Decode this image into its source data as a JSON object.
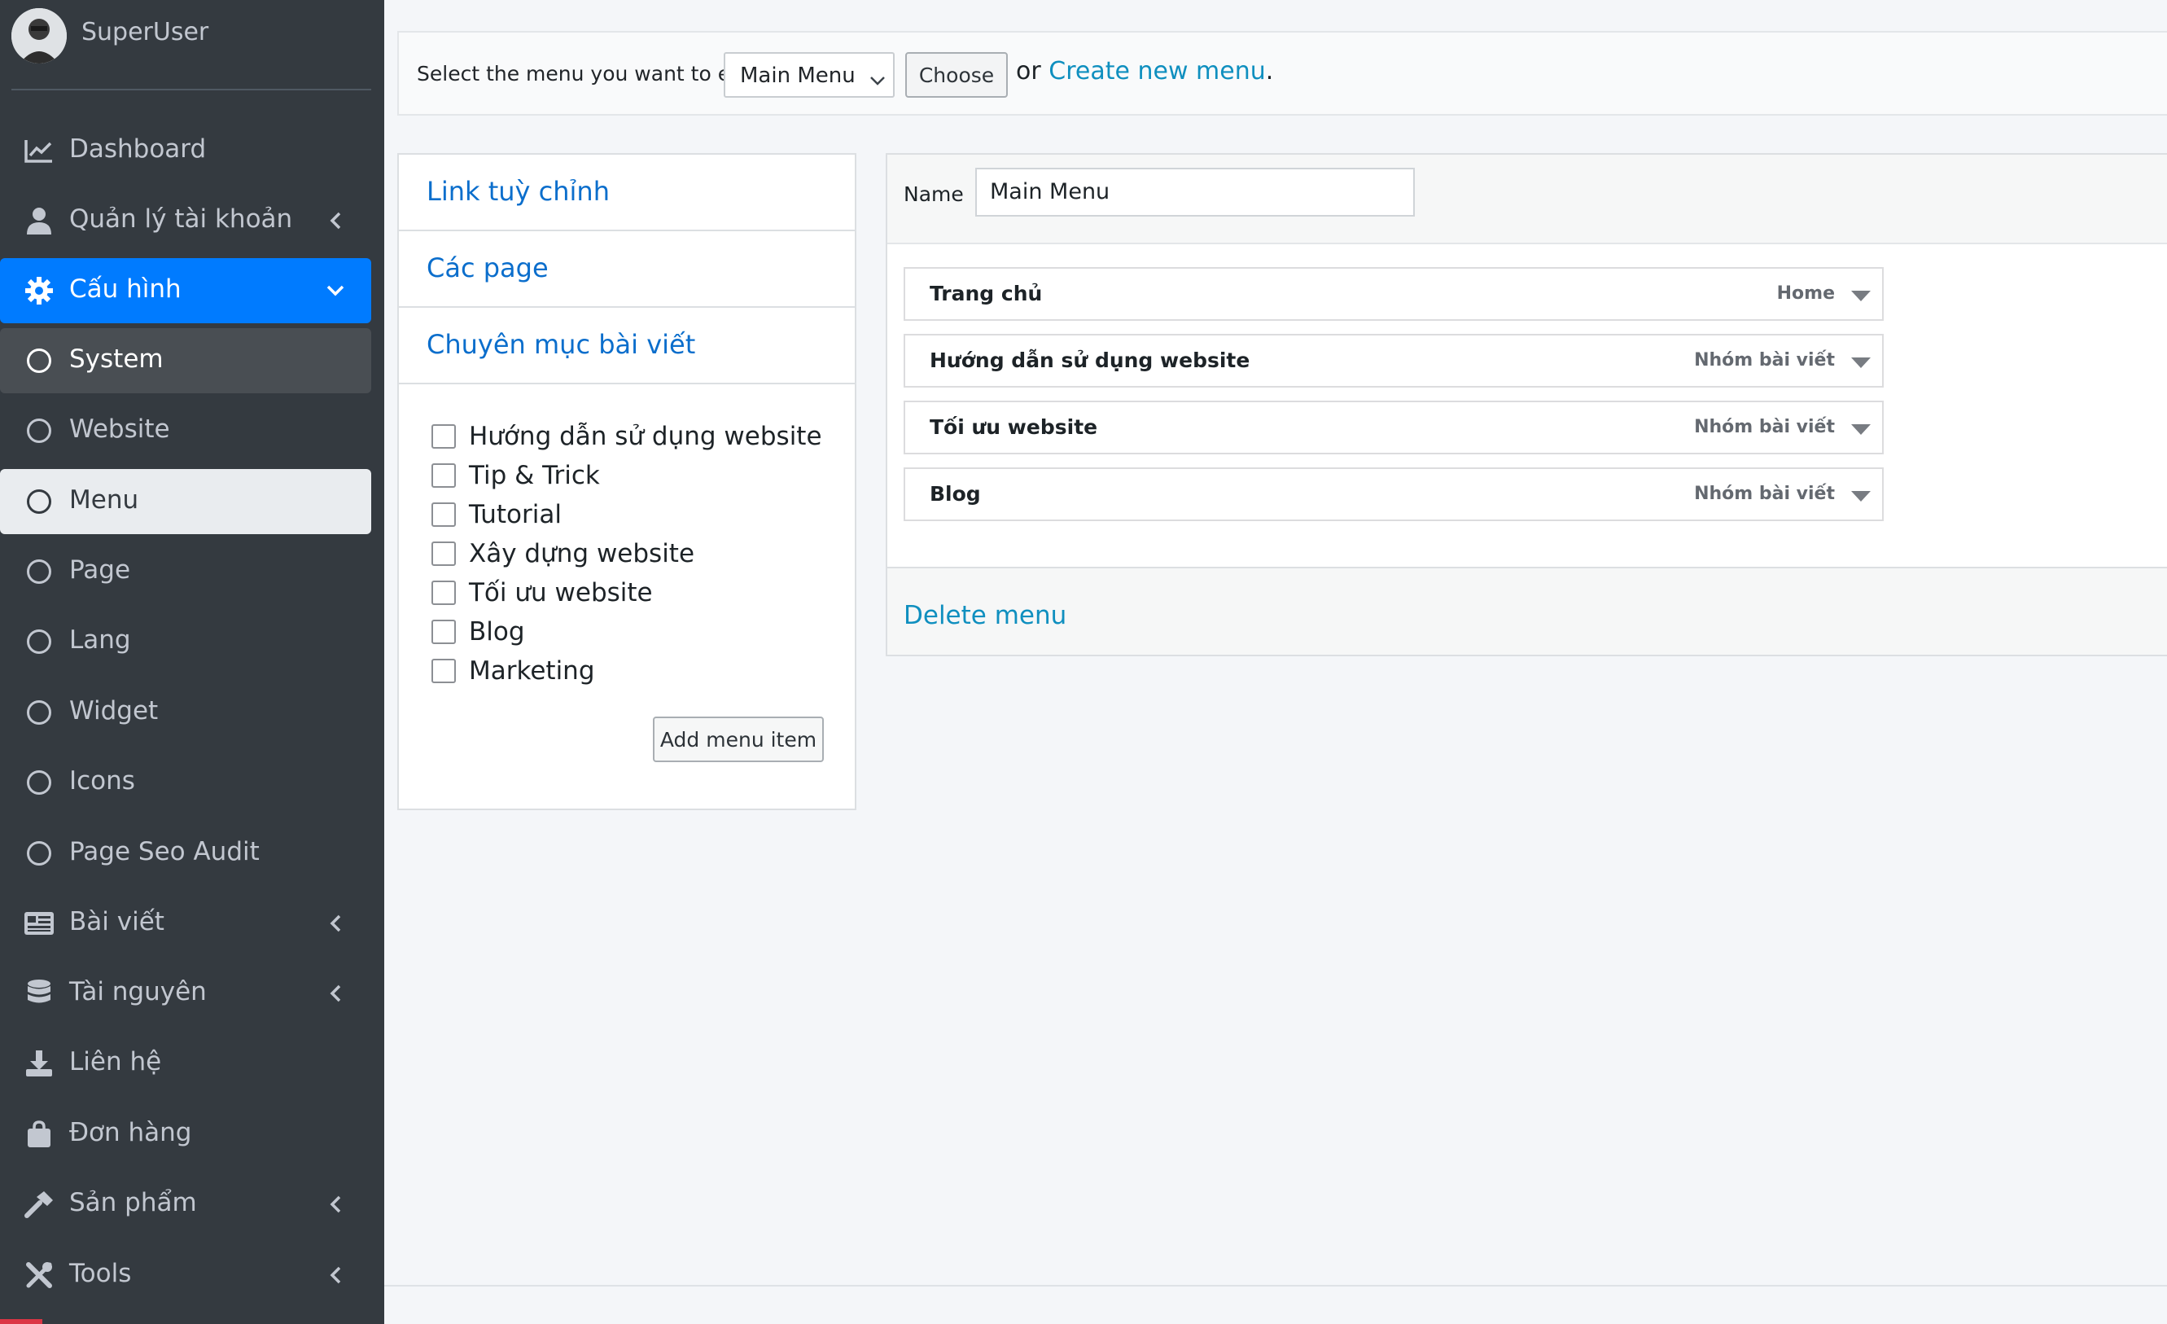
{
  "user": {
    "name": "SuperUser"
  },
  "sidebar": {
    "items": [
      {
        "label": "Dashboard",
        "icon": "chart-line-icon"
      },
      {
        "label": "Quản lý tài khoản",
        "icon": "user-icon",
        "has_children": true
      },
      {
        "label": "Cấu hình",
        "icon": "gear-icon",
        "has_children": true,
        "active": true
      },
      {
        "label": "System",
        "icon": "circle-icon"
      },
      {
        "label": "Website",
        "icon": "circle-icon"
      },
      {
        "label": "Menu",
        "icon": "circle-icon",
        "current": true
      },
      {
        "label": "Page",
        "icon": "circle-icon"
      },
      {
        "label": "Lang",
        "icon": "circle-icon"
      },
      {
        "label": "Widget",
        "icon": "circle-icon"
      },
      {
        "label": "Icons",
        "icon": "circle-icon"
      },
      {
        "label": "Page Seo Audit",
        "icon": "circle-icon"
      },
      {
        "label": "Bài viết",
        "icon": "newspaper-icon",
        "has_children": true
      },
      {
        "label": "Tài nguyên",
        "icon": "database-icon",
        "has_children": true
      },
      {
        "label": "Liên hệ",
        "icon": "download-icon"
      },
      {
        "label": "Đơn hàng",
        "icon": "shopping-bag-icon"
      },
      {
        "label": "Sản phẩm",
        "icon": "hammer-icon",
        "has_children": true
      },
      {
        "label": "Tools",
        "icon": "tools-icon",
        "has_children": true
      }
    ]
  },
  "topbar": {
    "select_label": "Select the menu you want to edit:",
    "selected_menu": "Main Menu",
    "choose_label": "Choose",
    "or_text": "or",
    "create_link": "Create new menu",
    "period": "."
  },
  "accordion": {
    "sections": [
      "Link tuỳ chỉnh",
      "Các page",
      "Chuyên mục bài viết"
    ],
    "categories": [
      "Hướng dẫn sử dụng website",
      "Tip & Trick",
      "Tutorial",
      "Xây dựng website",
      "Tối ưu website",
      "Blog",
      "Marketing"
    ],
    "add_button": "Add menu item"
  },
  "menu_structure": {
    "name_label": "Name",
    "name_value": "Main Menu",
    "items": [
      {
        "title": "Trang chủ",
        "type": "Home"
      },
      {
        "title": "Hướng dẫn sử dụng website",
        "type": "Nhóm bài viết"
      },
      {
        "title": "Tối ưu website",
        "type": "Nhóm bài viết"
      },
      {
        "title": "Blog",
        "type": "Nhóm bài viết"
      }
    ],
    "delete_link": "Delete menu"
  },
  "colors": {
    "sidebar_bg": "#343a40",
    "active_blue": "#007bff",
    "link_blue": "#0b6ecc",
    "link_teal": "#0f8fbf"
  }
}
